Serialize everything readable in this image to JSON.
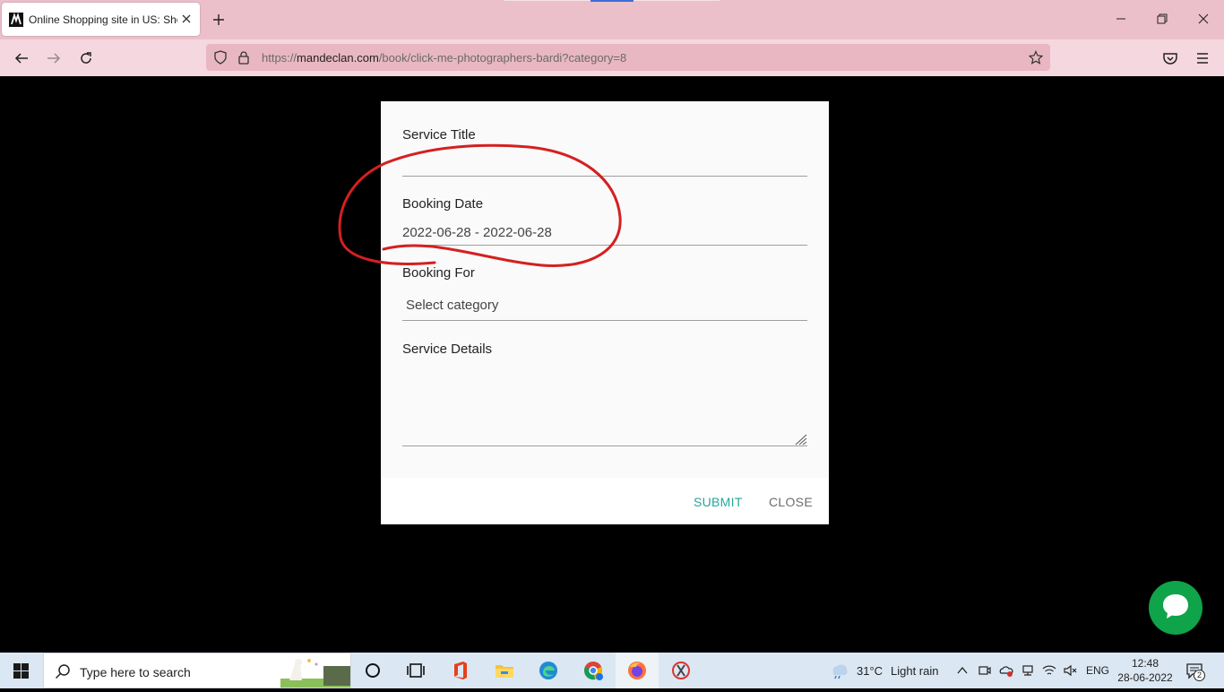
{
  "browser": {
    "tab_title": "Online Shopping site in US: Sho",
    "url_scheme": "https://",
    "url_host": "mandeclan.com",
    "url_path": "/book/click-me-photographers-bardi?category=8"
  },
  "modal": {
    "service_title_label": "Service Title",
    "service_title_value": "",
    "booking_date_label": "Booking Date",
    "booking_date_value": "2022-06-28 - 2022-06-28",
    "booking_for_label": "Booking For",
    "booking_for_placeholder": "Select category",
    "service_details_label": "Service Details",
    "submit_label": "SUBMIT",
    "close_label": "CLOSE"
  },
  "annotation": {
    "color": "#d42020"
  },
  "chat": {
    "color": "#0fa34a"
  },
  "taskbar": {
    "search_placeholder": "Type here to search",
    "weather_temp": "31°C",
    "weather_text": "Light rain",
    "language": "ENG",
    "time": "12:48",
    "date": "28-06-2022",
    "notification_count": "2"
  },
  "icons": [
    "favicon-m-icon",
    "close-icon",
    "plus-icon",
    "minimize-icon",
    "restore-icon",
    "back-icon",
    "forward-icon",
    "reload-icon",
    "shield-icon",
    "lock-icon",
    "star-icon",
    "pocket-icon",
    "menu-icon",
    "chat-icon",
    "windows-icon",
    "search-icon",
    "cortana-icon",
    "task-view-icon",
    "office-icon",
    "file-explorer-icon",
    "edge-icon",
    "chrome-icon",
    "firefox-icon",
    "app-icon",
    "weather-icon",
    "chevron-up-icon",
    "meet-icon",
    "onedrive-icon",
    "network-icon",
    "wifi-icon",
    "volume-icon",
    "notification-icon"
  ]
}
